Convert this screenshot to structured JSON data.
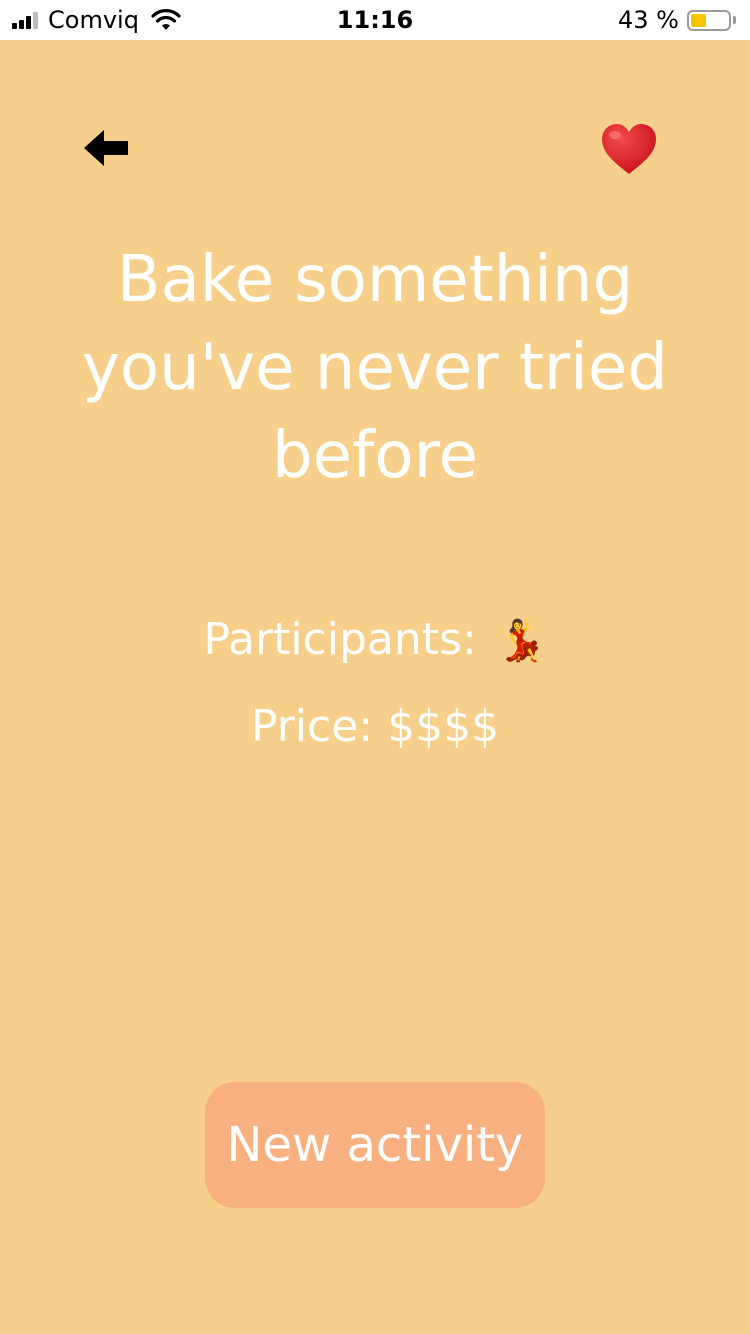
{
  "status_bar": {
    "carrier": "Comviq",
    "time": "11:16",
    "battery_percent": "43 %",
    "battery_level": 0.43,
    "battery_color": "#F4C600",
    "icons": [
      "signal-icon",
      "wifi-icon",
      "battery-icon"
    ]
  },
  "header": {
    "back_icon": "left-arrow-icon",
    "favorite_icon": "heart-icon",
    "favorite_color": "#D9141E"
  },
  "activity": {
    "title": "Bake something you've never tried before",
    "participants_label": "Participants:",
    "participants_icon": "💃",
    "price_label": "Price: $$$$"
  },
  "actions": {
    "new_activity_label": "New activity"
  },
  "colors": {
    "background": "#F6D08B",
    "button": "#F8B080",
    "text": "#FFFFFF"
  }
}
